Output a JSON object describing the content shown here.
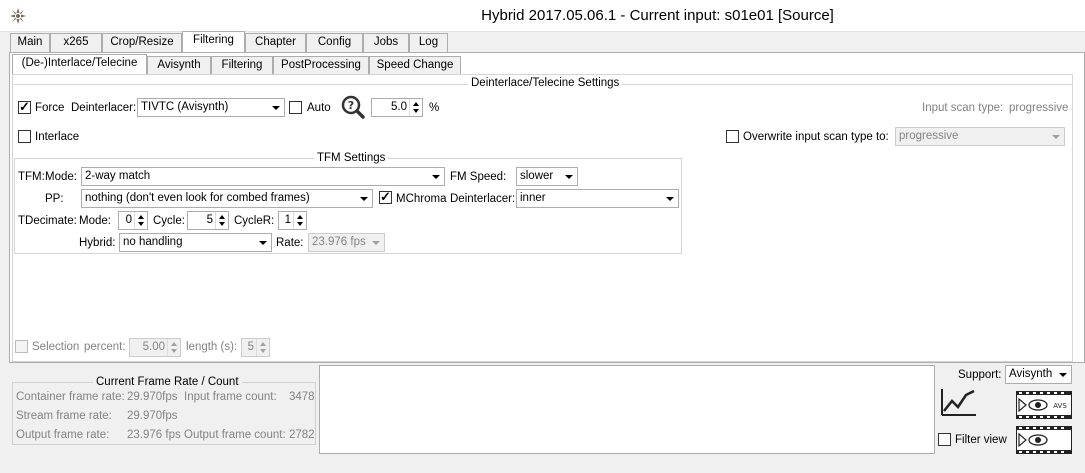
{
  "window": {
    "title": "Hybrid 2017.05.06.1 - Current input: s01e01 [Source]"
  },
  "main_tabs": [
    {
      "label": "Main"
    },
    {
      "label": "x265"
    },
    {
      "label": "Crop/Resize"
    },
    {
      "label": "Filtering"
    },
    {
      "label": "Chapter"
    },
    {
      "label": "Config"
    },
    {
      "label": "Jobs"
    },
    {
      "label": "Log"
    }
  ],
  "sub_tabs": [
    {
      "label": "(De-)Interlace/Telecine"
    },
    {
      "label": "Avisynth"
    },
    {
      "label": "Filtering"
    },
    {
      "label": "PostProcessing"
    },
    {
      "label": "Speed Change"
    }
  ],
  "deint": {
    "group_title": "Deinterlace/Telecine Settings",
    "force_label": "Force",
    "deinterlacer_label": "Deinterlacer:",
    "deinterlacer_value": "TIVTC (Avisynth)",
    "auto_label": "Auto",
    "threshold_value": "5.0",
    "percent_label": "%",
    "input_scan_label": "Input scan type:",
    "input_scan_value": "progressive",
    "interlace_label": "Interlace",
    "overwrite_label": "Overwrite input scan type to:",
    "overwrite_value": "progressive"
  },
  "tfm": {
    "group_title": "TFM Settings",
    "tfm_label": "TFM:",
    "mode_label": "Mode:",
    "mode_value": "2-way match",
    "fm_speed_label": "FM Speed:",
    "fm_speed_value": "slower",
    "pp_label": "PP:",
    "pp_value": "nothing (don't even look for combed frames)",
    "mchroma_label": "MChroma",
    "deinterlacer_label": "Deinterlacer:",
    "deinterlacer_value": "inner",
    "tdecimate_label": "TDecimate:",
    "td_mode_label": "Mode:",
    "td_mode_value": "0",
    "cycle_label": "Cycle:",
    "cycle_value": "5",
    "cycler_label": "CycleR:",
    "cycler_value": "1",
    "hybrid_label": "Hybrid:",
    "hybrid_value": "no handling",
    "rate_label": "Rate:",
    "rate_value": "23.976 fps"
  },
  "selection": {
    "selection_label": "Selection",
    "percent_label": "percent:",
    "percent_value": "5.00",
    "length_label": "length (s):",
    "length_value": "5"
  },
  "frame_rate": {
    "group_title": "Current Frame Rate / Count",
    "container_label": "Container frame rate:",
    "container_value": "29.970fps",
    "stream_label": "Stream frame rate:",
    "stream_value": "29.970fps",
    "output_label": "Output frame rate:",
    "output_value": "23.976 fps",
    "input_count_label": "Input frame count:",
    "input_count_value": "3478",
    "output_count_label": "Output frame count:",
    "output_count_value": "2782"
  },
  "support": {
    "label": "Support:",
    "value": "Avisynth",
    "filter_view_label": "Filter view",
    "avs_badge": "AVS"
  }
}
